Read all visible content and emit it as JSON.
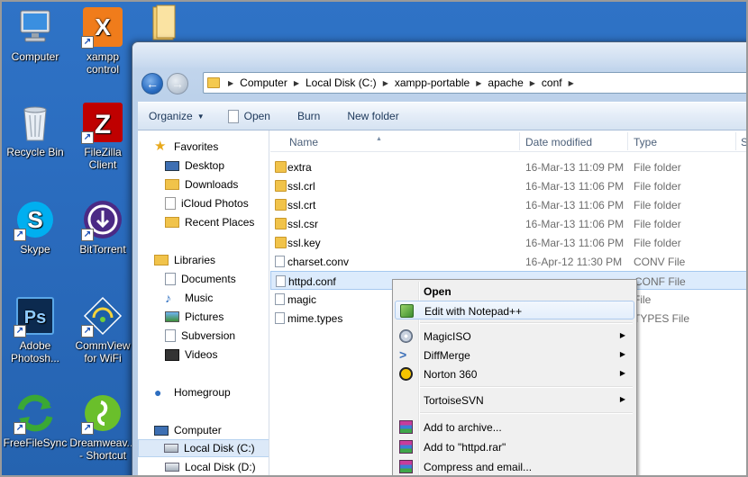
{
  "desktop_icons": [
    {
      "id": "computer",
      "label": "Computer",
      "icon": "computer-icon"
    },
    {
      "id": "xampp",
      "label": "xampp control",
      "icon": "xampp-icon",
      "shortcut": true
    },
    {
      "id": "folder",
      "label": "",
      "icon": "folder-icon"
    },
    {
      "id": "recycle",
      "label": "Recycle Bin",
      "icon": "recycle-bin-icon"
    },
    {
      "id": "filezilla",
      "label": "FileZilla Client",
      "icon": "filezilla-icon",
      "shortcut": true
    },
    {
      "id": "skype",
      "label": "Skype",
      "icon": "skype-icon",
      "shortcut": true
    },
    {
      "id": "bittorrent",
      "label": "BitTorrent",
      "icon": "bittorrent-icon",
      "shortcut": true
    },
    {
      "id": "photoshop",
      "label": "Adobe Photosh...",
      "icon": "photoshop-icon",
      "shortcut": true
    },
    {
      "id": "commview",
      "label": "CommView for WiFi",
      "icon": "commview-icon",
      "shortcut": true
    },
    {
      "id": "freefilesync",
      "label": "FreeFileSync",
      "icon": "freefilesync-icon",
      "shortcut": true
    },
    {
      "id": "dreamweaver",
      "label": "Dreamweav... - Shortcut",
      "icon": "dreamweaver-icon",
      "shortcut": true
    }
  ],
  "explorer": {
    "address": {
      "crumbs": [
        "Computer",
        "Local Disk (C:)",
        "xampp-portable",
        "apache",
        "conf"
      ]
    },
    "toolbar": {
      "organize": "Organize",
      "open": "Open",
      "burn": "Burn",
      "new_folder": "New folder"
    },
    "nav": {
      "favorites": "Favorites",
      "desktop": "Desktop",
      "downloads": "Downloads",
      "icloud": "iCloud Photos",
      "recent": "Recent Places",
      "libraries": "Libraries",
      "documents": "Documents",
      "music": "Music",
      "pictures": "Pictures",
      "subversion": "Subversion",
      "videos": "Videos",
      "homegroup": "Homegroup",
      "computer": "Computer",
      "local_c": "Local Disk (C:)",
      "local_d": "Local Disk (D:)"
    },
    "columns": {
      "name": "Name",
      "date": "Date modified",
      "type": "Type",
      "size": "S"
    },
    "files": [
      {
        "name": "extra",
        "date": "16-Mar-13 11:09 PM",
        "type": "File folder",
        "kind": "folder"
      },
      {
        "name": "ssl.crl",
        "date": "16-Mar-13 11:06 PM",
        "type": "File folder",
        "kind": "folder"
      },
      {
        "name": "ssl.crt",
        "date": "16-Mar-13 11:06 PM",
        "type": "File folder",
        "kind": "folder"
      },
      {
        "name": "ssl.csr",
        "date": "16-Mar-13 11:06 PM",
        "type": "File folder",
        "kind": "folder"
      },
      {
        "name": "ssl.key",
        "date": "16-Mar-13 11:06 PM",
        "type": "File folder",
        "kind": "folder"
      },
      {
        "name": "charset.conv",
        "date": "16-Apr-12 11:30 PM",
        "type": "CONV File",
        "kind": "file"
      },
      {
        "name": "httpd.conf",
        "date": "",
        "type": "CONF File",
        "kind": "file",
        "selected": true
      },
      {
        "name": "magic",
        "date": "",
        "type": "File",
        "kind": "file"
      },
      {
        "name": "mime.types",
        "date": "",
        "type": "TYPES File",
        "kind": "file"
      }
    ]
  },
  "context_menu": {
    "open": "Open",
    "edit_notepad": "Edit with Notepad++",
    "magiciso": "MagicISO",
    "diffmerge": "DiffMerge",
    "norton": "Norton 360",
    "tortoisesvn": "TortoiseSVN",
    "add_archive": "Add to archive...",
    "add_rar": "Add to \"httpd.rar\"",
    "compress_email": "Compress and email..."
  }
}
